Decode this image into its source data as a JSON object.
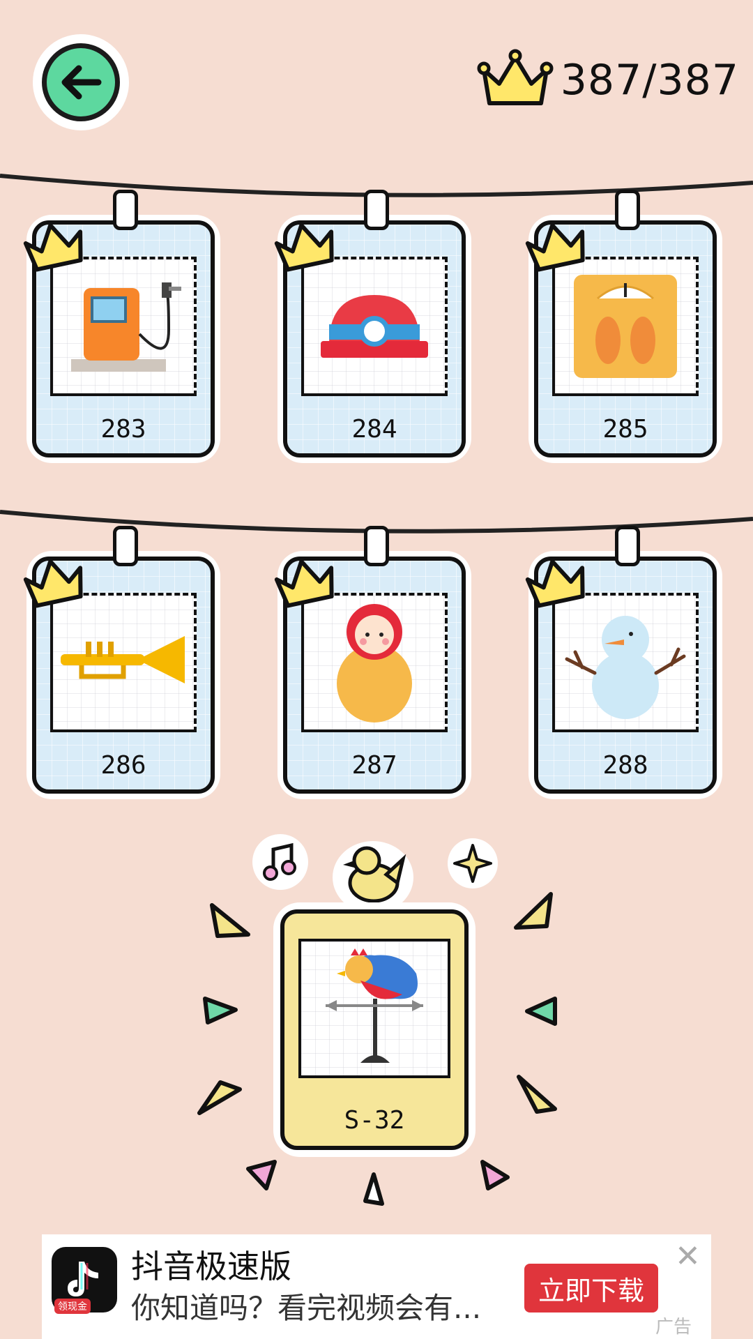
{
  "header": {
    "back_icon": "arrow-left-icon",
    "crown_count": "387/387"
  },
  "cards": [
    {
      "label": "283",
      "icon": "gas-pump-icon"
    },
    {
      "label": "284",
      "icon": "miner-hat-icon"
    },
    {
      "label": "285",
      "icon": "bathroom-scale-icon"
    },
    {
      "label": "286",
      "icon": "trumpet-icon"
    },
    {
      "label": "287",
      "icon": "matryoshka-doll-icon"
    },
    {
      "label": "288",
      "icon": "snowman-icon"
    }
  ],
  "special_card": {
    "label": "S-32",
    "icon": "weathervane-rooster-icon"
  },
  "ad": {
    "title": "抖音极速版",
    "description": "你知道吗？看完视频会有...",
    "button": "立即下载",
    "badge": "领现金",
    "tag": "广告",
    "close": "✕"
  },
  "colors": {
    "background": "#f6ddd2",
    "card": "#d9ecf8",
    "special_card": "#f6e69a",
    "crown": "#ffe76a",
    "back_button": "#5dd89f",
    "ad_button": "#e0353c"
  }
}
